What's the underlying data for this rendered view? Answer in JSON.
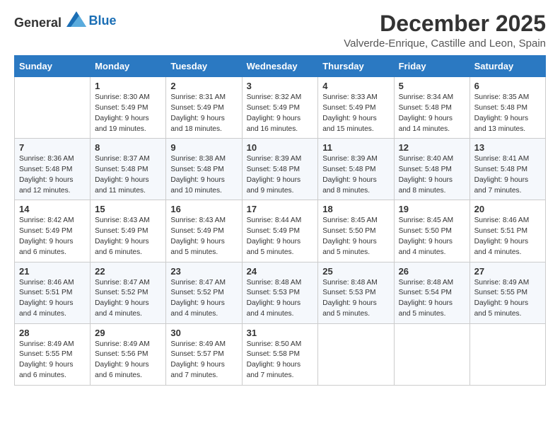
{
  "logo": {
    "general": "General",
    "blue": "Blue"
  },
  "header": {
    "month": "December 2025",
    "location": "Valverde-Enrique, Castille and Leon, Spain"
  },
  "weekdays": [
    "Sunday",
    "Monday",
    "Tuesday",
    "Wednesday",
    "Thursday",
    "Friday",
    "Saturday"
  ],
  "weeks": [
    [
      {
        "day": "",
        "sunrise": "",
        "sunset": "",
        "daylight": ""
      },
      {
        "day": "1",
        "sunrise": "Sunrise: 8:30 AM",
        "sunset": "Sunset: 5:49 PM",
        "daylight": "Daylight: 9 hours and 19 minutes."
      },
      {
        "day": "2",
        "sunrise": "Sunrise: 8:31 AM",
        "sunset": "Sunset: 5:49 PM",
        "daylight": "Daylight: 9 hours and 18 minutes."
      },
      {
        "day": "3",
        "sunrise": "Sunrise: 8:32 AM",
        "sunset": "Sunset: 5:49 PM",
        "daylight": "Daylight: 9 hours and 16 minutes."
      },
      {
        "day": "4",
        "sunrise": "Sunrise: 8:33 AM",
        "sunset": "Sunset: 5:49 PM",
        "daylight": "Daylight: 9 hours and 15 minutes."
      },
      {
        "day": "5",
        "sunrise": "Sunrise: 8:34 AM",
        "sunset": "Sunset: 5:48 PM",
        "daylight": "Daylight: 9 hours and 14 minutes."
      },
      {
        "day": "6",
        "sunrise": "Sunrise: 8:35 AM",
        "sunset": "Sunset: 5:48 PM",
        "daylight": "Daylight: 9 hours and 13 minutes."
      }
    ],
    [
      {
        "day": "7",
        "sunrise": "Sunrise: 8:36 AM",
        "sunset": "Sunset: 5:48 PM",
        "daylight": "Daylight: 9 hours and 12 minutes."
      },
      {
        "day": "8",
        "sunrise": "Sunrise: 8:37 AM",
        "sunset": "Sunset: 5:48 PM",
        "daylight": "Daylight: 9 hours and 11 minutes."
      },
      {
        "day": "9",
        "sunrise": "Sunrise: 8:38 AM",
        "sunset": "Sunset: 5:48 PM",
        "daylight": "Daylight: 9 hours and 10 minutes."
      },
      {
        "day": "10",
        "sunrise": "Sunrise: 8:39 AM",
        "sunset": "Sunset: 5:48 PM",
        "daylight": "Daylight: 9 hours and 9 minutes."
      },
      {
        "day": "11",
        "sunrise": "Sunrise: 8:39 AM",
        "sunset": "Sunset: 5:48 PM",
        "daylight": "Daylight: 9 hours and 8 minutes."
      },
      {
        "day": "12",
        "sunrise": "Sunrise: 8:40 AM",
        "sunset": "Sunset: 5:48 PM",
        "daylight": "Daylight: 9 hours and 8 minutes."
      },
      {
        "day": "13",
        "sunrise": "Sunrise: 8:41 AM",
        "sunset": "Sunset: 5:48 PM",
        "daylight": "Daylight: 9 hours and 7 minutes."
      }
    ],
    [
      {
        "day": "14",
        "sunrise": "Sunrise: 8:42 AM",
        "sunset": "Sunset: 5:49 PM",
        "daylight": "Daylight: 9 hours and 6 minutes."
      },
      {
        "day": "15",
        "sunrise": "Sunrise: 8:43 AM",
        "sunset": "Sunset: 5:49 PM",
        "daylight": "Daylight: 9 hours and 6 minutes."
      },
      {
        "day": "16",
        "sunrise": "Sunrise: 8:43 AM",
        "sunset": "Sunset: 5:49 PM",
        "daylight": "Daylight: 9 hours and 5 minutes."
      },
      {
        "day": "17",
        "sunrise": "Sunrise: 8:44 AM",
        "sunset": "Sunset: 5:49 PM",
        "daylight": "Daylight: 9 hours and 5 minutes."
      },
      {
        "day": "18",
        "sunrise": "Sunrise: 8:45 AM",
        "sunset": "Sunset: 5:50 PM",
        "daylight": "Daylight: 9 hours and 5 minutes."
      },
      {
        "day": "19",
        "sunrise": "Sunrise: 8:45 AM",
        "sunset": "Sunset: 5:50 PM",
        "daylight": "Daylight: 9 hours and 4 minutes."
      },
      {
        "day": "20",
        "sunrise": "Sunrise: 8:46 AM",
        "sunset": "Sunset: 5:51 PM",
        "daylight": "Daylight: 9 hours and 4 minutes."
      }
    ],
    [
      {
        "day": "21",
        "sunrise": "Sunrise: 8:46 AM",
        "sunset": "Sunset: 5:51 PM",
        "daylight": "Daylight: 9 hours and 4 minutes."
      },
      {
        "day": "22",
        "sunrise": "Sunrise: 8:47 AM",
        "sunset": "Sunset: 5:52 PM",
        "daylight": "Daylight: 9 hours and 4 minutes."
      },
      {
        "day": "23",
        "sunrise": "Sunrise: 8:47 AM",
        "sunset": "Sunset: 5:52 PM",
        "daylight": "Daylight: 9 hours and 4 minutes."
      },
      {
        "day": "24",
        "sunrise": "Sunrise: 8:48 AM",
        "sunset": "Sunset: 5:53 PM",
        "daylight": "Daylight: 9 hours and 4 minutes."
      },
      {
        "day": "25",
        "sunrise": "Sunrise: 8:48 AM",
        "sunset": "Sunset: 5:53 PM",
        "daylight": "Daylight: 9 hours and 5 minutes."
      },
      {
        "day": "26",
        "sunrise": "Sunrise: 8:48 AM",
        "sunset": "Sunset: 5:54 PM",
        "daylight": "Daylight: 9 hours and 5 minutes."
      },
      {
        "day": "27",
        "sunrise": "Sunrise: 8:49 AM",
        "sunset": "Sunset: 5:55 PM",
        "daylight": "Daylight: 9 hours and 5 minutes."
      }
    ],
    [
      {
        "day": "28",
        "sunrise": "Sunrise: 8:49 AM",
        "sunset": "Sunset: 5:55 PM",
        "daylight": "Daylight: 9 hours and 6 minutes."
      },
      {
        "day": "29",
        "sunrise": "Sunrise: 8:49 AM",
        "sunset": "Sunset: 5:56 PM",
        "daylight": "Daylight: 9 hours and 6 minutes."
      },
      {
        "day": "30",
        "sunrise": "Sunrise: 8:49 AM",
        "sunset": "Sunset: 5:57 PM",
        "daylight": "Daylight: 9 hours and 7 minutes."
      },
      {
        "day": "31",
        "sunrise": "Sunrise: 8:50 AM",
        "sunset": "Sunset: 5:58 PM",
        "daylight": "Daylight: 9 hours and 7 minutes."
      },
      {
        "day": "",
        "sunrise": "",
        "sunset": "",
        "daylight": ""
      },
      {
        "day": "",
        "sunrise": "",
        "sunset": "",
        "daylight": ""
      },
      {
        "day": "",
        "sunrise": "",
        "sunset": "",
        "daylight": ""
      }
    ]
  ]
}
